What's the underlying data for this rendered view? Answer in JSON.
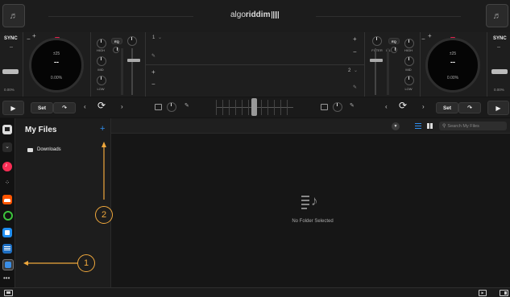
{
  "app": {
    "logo_thin": "algo",
    "logo_bold": "riddim"
  },
  "deck_left": {
    "sync": "SYNC",
    "sync_value": "--",
    "pitch": "0.00%",
    "bpm_range": "±25",
    "bpm": "--",
    "pitch_center": "0.00%",
    "set_label": "Set"
  },
  "deck_right": {
    "sync": "SYNC",
    "sync_value": "--",
    "pitch": "0.00%",
    "bpm_range": "±25",
    "bpm": "--",
    "pitch_center": "0.00%",
    "set_label": "Set"
  },
  "mixer": {
    "eq": "EQ",
    "high": "HIGH",
    "mid": "MID",
    "low": "LOW",
    "filter": "FILTER",
    "slot1": "1",
    "slot2": "2"
  },
  "library": {
    "title": "My Files",
    "add": "+",
    "folder": "Downloads",
    "empty": "No Folder Selected",
    "search_placeholder": "Search My Files"
  },
  "callouts": [
    {
      "label": "1"
    },
    {
      "label": "2"
    }
  ],
  "colors": {
    "accent": "#f0a83c",
    "blue": "#2f8ff0",
    "red": "#e0214d"
  }
}
